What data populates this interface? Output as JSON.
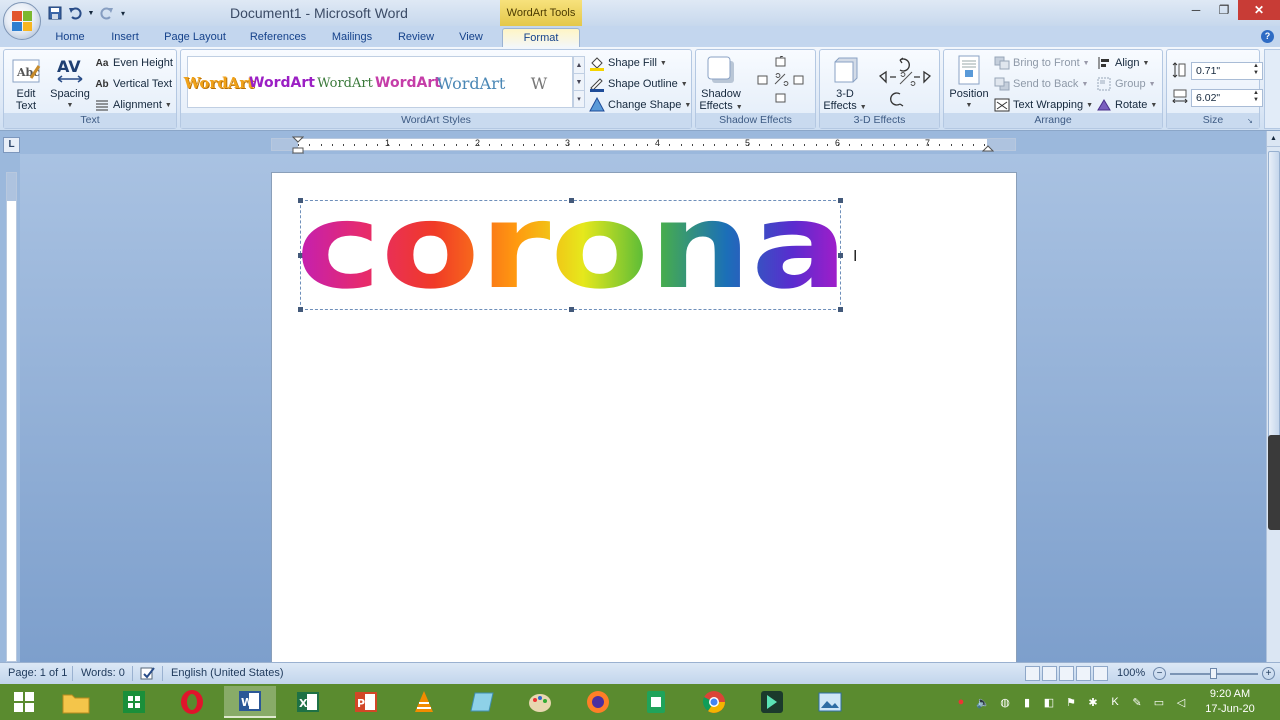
{
  "window": {
    "title": "Document1 - Microsoft Word",
    "contextual_tab": "WordArt Tools"
  },
  "tabs": [
    "Home",
    "Insert",
    "Page Layout",
    "References",
    "Mailings",
    "Review",
    "View",
    "Format"
  ],
  "active_tab": "Format",
  "ribbon": {
    "text_group": {
      "label": "Text",
      "edit_text": "Edit Text",
      "spacing": "Spacing",
      "even_height": "Even Height",
      "vertical_text": "Vertical Text",
      "alignment": "Alignment"
    },
    "wordart_styles": {
      "label": "WordArt Styles",
      "samples": [
        "WordArt",
        "WordArt",
        "WordArt",
        "WordArt",
        "WordArt",
        "W"
      ],
      "shape_fill": "Shape Fill",
      "shape_outline": "Shape Outline",
      "change_shape": "Change Shape"
    },
    "shadow_group": {
      "label": "Shadow Effects",
      "shadow_effects": "Shadow Effects"
    },
    "threed_group": {
      "label": "3-D Effects",
      "threed_effects": "3-D Effects"
    },
    "arrange": {
      "label": "Arrange",
      "position": "Position",
      "bring_to_front": "Bring to Front",
      "send_to_back": "Send to Back",
      "text_wrapping": "Text Wrapping",
      "align": "Align",
      "group": "Group",
      "rotate": "Rotate"
    },
    "size": {
      "label": "Size",
      "height": "0.71\"",
      "width": "6.02\""
    }
  },
  "ruler_numbers": [
    "1",
    "2",
    "3",
    "4",
    "5",
    "6",
    "7"
  ],
  "document": {
    "wordart_text": "corona"
  },
  "status": {
    "page": "Page: 1 of 1",
    "words": "Words: 0",
    "language": "English (United States)",
    "zoom": "100%"
  },
  "taskbar": {
    "time": "9:20 AM",
    "date": "17-Jun-20"
  },
  "colors": {
    "taskbar": "#5a8b2f",
    "close_button": "#c83c36",
    "ribbon_label": "#3e5b84"
  }
}
